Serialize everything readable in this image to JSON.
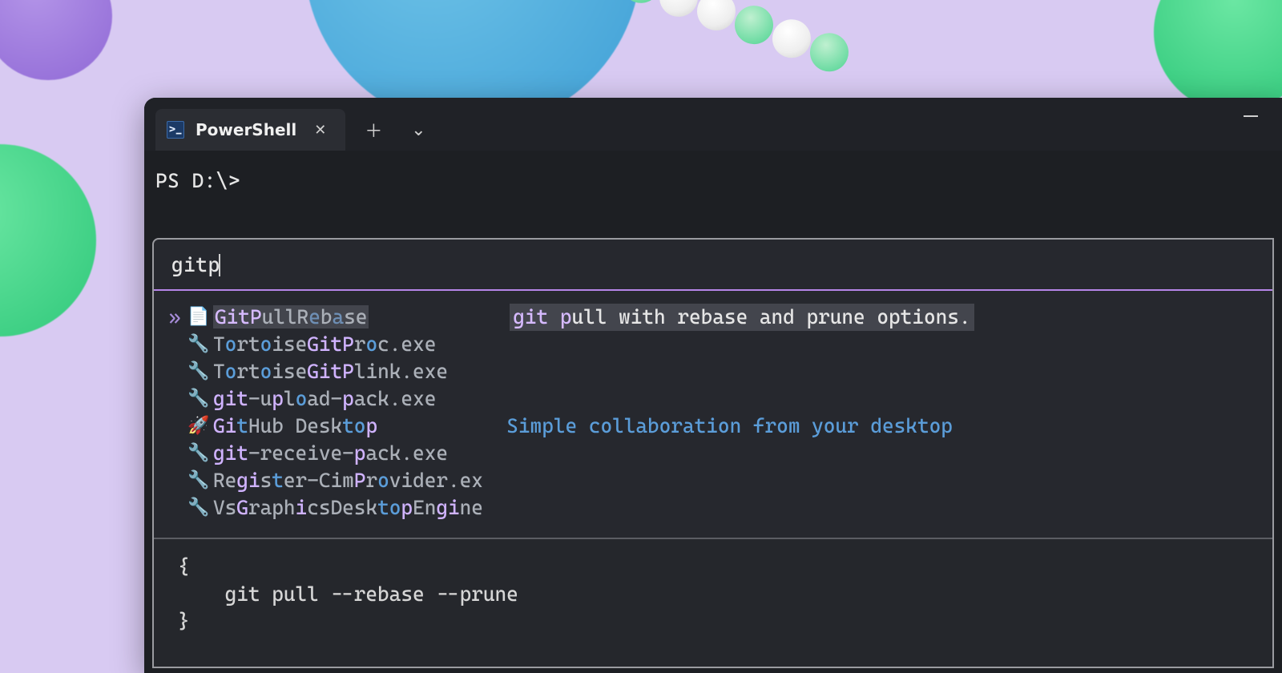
{
  "window": {
    "tab_title": "PowerShell",
    "close_glyph": "✕",
    "new_tab_glyph": "＋",
    "dropdown_glyph": "⌄",
    "minimize_glyph": "—"
  },
  "prompt": {
    "line": "PS D:\\>"
  },
  "palette": {
    "query": "gitp",
    "selected_marker": "»",
    "results": [
      {
        "icon": "📄",
        "segments": [
          {
            "t": "GitP",
            "cls": "hl-sel"
          },
          {
            "t": "ullR",
            "cls": "grey"
          },
          {
            "t": "e",
            "cls": "blue-dim"
          },
          {
            "t": "b",
            "cls": "grey"
          },
          {
            "t": "a",
            "cls": "blue-dim"
          },
          {
            "t": "se",
            "cls": "grey"
          }
        ],
        "selected": true,
        "desc_segments": [
          {
            "t": "git p",
            "cls": "pink"
          },
          {
            "t": "ull with rebase and prune options.",
            "cls": ""
          }
        ],
        "desc_boxed": true
      },
      {
        "icon": "🔧",
        "segments": [
          {
            "t": "T",
            "cls": "grey"
          },
          {
            "t": "o",
            "cls": "blue"
          },
          {
            "t": "rt",
            "cls": "grey"
          },
          {
            "t": "o",
            "cls": "blue"
          },
          {
            "t": "ise",
            "cls": "grey"
          },
          {
            "t": "GitP",
            "cls": "hl"
          },
          {
            "t": "r",
            "cls": "grey"
          },
          {
            "t": "o",
            "cls": "blue"
          },
          {
            "t": "c.exe",
            "cls": "grey"
          }
        ]
      },
      {
        "icon": "🔧",
        "segments": [
          {
            "t": "T",
            "cls": "grey"
          },
          {
            "t": "o",
            "cls": "blue"
          },
          {
            "t": "rt",
            "cls": "grey"
          },
          {
            "t": "o",
            "cls": "blue"
          },
          {
            "t": "ise",
            "cls": "grey"
          },
          {
            "t": "GitP",
            "cls": "hl"
          },
          {
            "t": "link.exe",
            "cls": "grey"
          }
        ]
      },
      {
        "icon": "🔧",
        "segments": [
          {
            "t": "git",
            "cls": "hl"
          },
          {
            "t": "-u",
            "cls": "grey"
          },
          {
            "t": "p",
            "cls": "hl"
          },
          {
            "t": "l",
            "cls": "grey"
          },
          {
            "t": "o",
            "cls": "blue"
          },
          {
            "t": "ad-",
            "cls": "grey"
          },
          {
            "t": "p",
            "cls": "hl"
          },
          {
            "t": "ack.exe",
            "cls": "grey"
          }
        ]
      },
      {
        "icon": "🚀",
        "segments": [
          {
            "t": "Gi",
            "cls": "hl"
          },
          {
            "t": "t",
            "cls": "blue"
          },
          {
            "t": "Hub Desk",
            "cls": "grey"
          },
          {
            "t": "t",
            "cls": "blue"
          },
          {
            "t": "o",
            "cls": "blue"
          },
          {
            "t": "p",
            "cls": "hl"
          }
        ],
        "desc_segments": [
          {
            "t": "Simple collaboration from your desktop",
            "cls": "blue"
          }
        ]
      },
      {
        "icon": "🔧",
        "segments": [
          {
            "t": "git",
            "cls": "hl"
          },
          {
            "t": "-receive-",
            "cls": "grey"
          },
          {
            "t": "p",
            "cls": "hl"
          },
          {
            "t": "ack.exe",
            "cls": "grey"
          }
        ]
      },
      {
        "icon": "🔧",
        "segments": [
          {
            "t": "Re",
            "cls": "grey"
          },
          {
            "t": "gi",
            "cls": "hl"
          },
          {
            "t": "s",
            "cls": "grey"
          },
          {
            "t": "t",
            "cls": "blue"
          },
          {
            "t": "er-Cim",
            "cls": "grey"
          },
          {
            "t": "P",
            "cls": "hl"
          },
          {
            "t": "r",
            "cls": "grey"
          },
          {
            "t": "o",
            "cls": "blue"
          },
          {
            "t": "vider.ex",
            "cls": "grey"
          }
        ]
      },
      {
        "icon": "🔧",
        "segments": [
          {
            "t": "Vs",
            "cls": "grey"
          },
          {
            "t": "G",
            "cls": "hl"
          },
          {
            "t": "raph",
            "cls": "grey"
          },
          {
            "t": "i",
            "cls": "hl"
          },
          {
            "t": "csDesk",
            "cls": "grey"
          },
          {
            "t": "t",
            "cls": "blue"
          },
          {
            "t": "o",
            "cls": "blue"
          },
          {
            "t": "p",
            "cls": "hl"
          },
          {
            "t": "En",
            "cls": "grey"
          },
          {
            "t": "gi",
            "cls": "hl"
          },
          {
            "t": "ne",
            "cls": "grey"
          }
        ]
      }
    ],
    "preview": "{\n    git pull --rebase --prune\n}"
  }
}
